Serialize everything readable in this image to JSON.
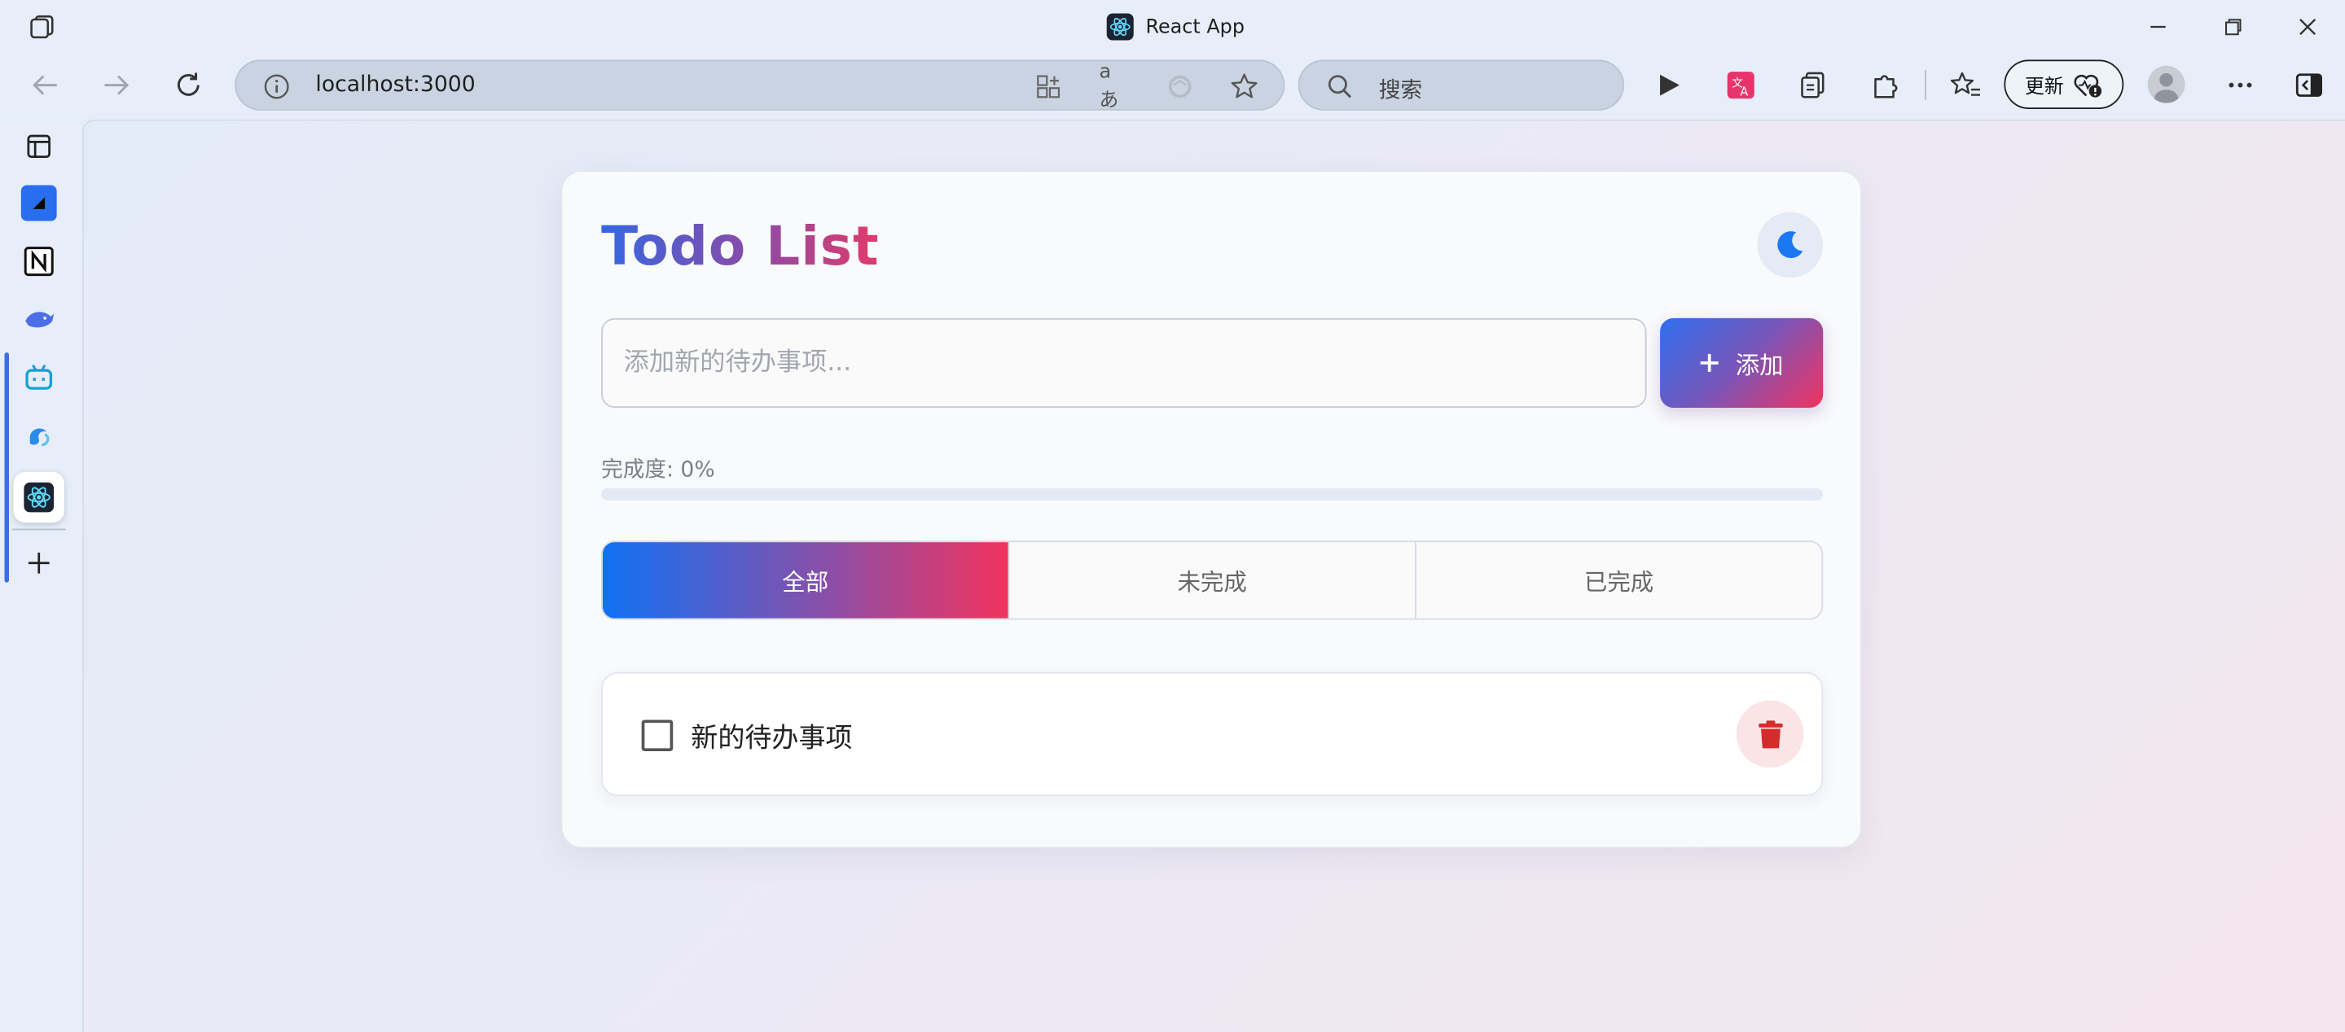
{
  "window": {
    "title": "React App"
  },
  "toolbar": {
    "address": "localhost:3000",
    "search_placeholder": "搜索",
    "update_label": "更新"
  },
  "sidebar": {
    "items": [
      "vertical-tabs",
      "blue-app",
      "notion",
      "dolphin",
      "bilibili",
      "bird",
      "react-app",
      "add"
    ]
  },
  "app": {
    "heading": "Todo List",
    "input_placeholder": "添加新的待办事项...",
    "add_label": "添加",
    "progress_label": "完成度: 0%",
    "progress_fraction": 0,
    "filters": [
      "全部",
      "未完成",
      "已完成"
    ],
    "active_filter": "全部",
    "todos": [
      {
        "text": "新的待办事项",
        "completed": false
      }
    ]
  },
  "colors": {
    "accent_blue": "#1071f5",
    "accent_pink": "#f1335d",
    "delete_red": "#d62b2b"
  }
}
